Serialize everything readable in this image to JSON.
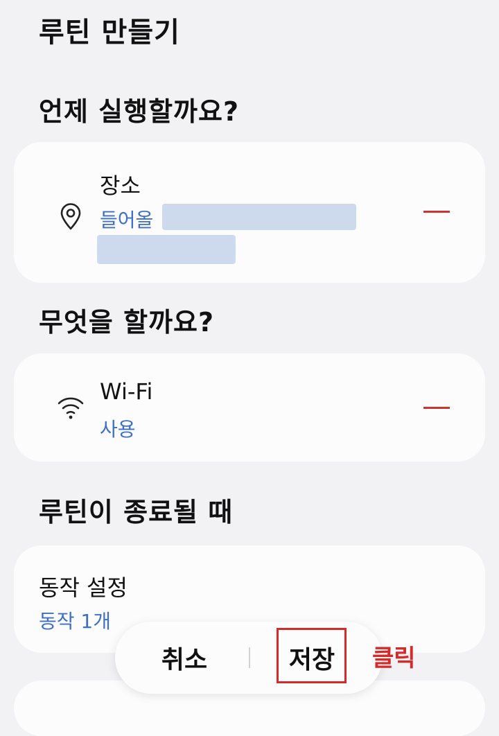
{
  "page": {
    "title": "루틴 만들기"
  },
  "when_section": {
    "heading": "언제 실행할까요?",
    "condition": {
      "icon": "location-pin-icon",
      "title": "장소",
      "subtitle": "들어올"
    }
  },
  "what_section": {
    "heading": "무엇을 할까요?",
    "action": {
      "icon": "wifi-icon",
      "title": "Wi-Fi",
      "subtitle": "사용"
    }
  },
  "end_section": {
    "heading": "루틴이 종료될 때",
    "action": {
      "title": "동작 설정",
      "subtitle": "동작 1개"
    }
  },
  "bottom_bar": {
    "cancel_label": "취소",
    "save_label": "저장"
  },
  "annotation": {
    "label": "클릭"
  },
  "colors": {
    "accent_blue": "#3d6fc8",
    "remove_red": "#cc3333",
    "annotation_red": "#d42a2a",
    "background": "#f2f2f4",
    "card": "#fcfcfd"
  }
}
